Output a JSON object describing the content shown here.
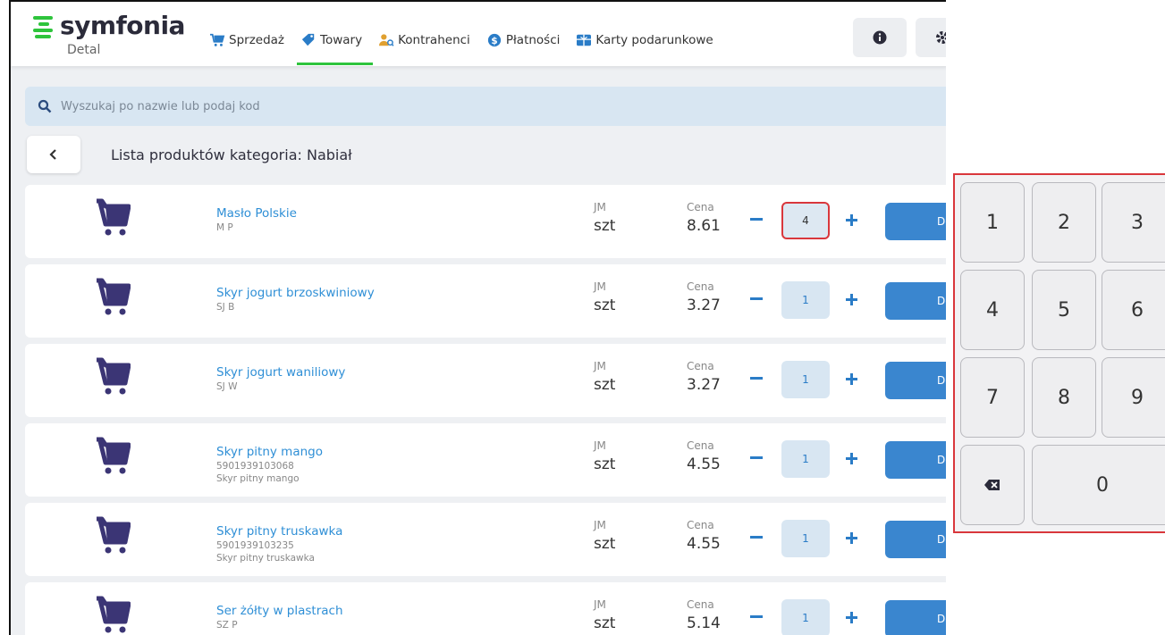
{
  "app": {
    "logo_name": "symfonia",
    "logo_sub": "Detal",
    "brand_color": "#2ec43c"
  },
  "nav": {
    "items": [
      {
        "label": "Sprzedaż",
        "icon": "cart-icon"
      },
      {
        "label": "Towary",
        "icon": "tag-icon"
      },
      {
        "label": "Kontrahenci",
        "icon": "users-icon"
      },
      {
        "label": "Płatności",
        "icon": "dollar-icon"
      },
      {
        "label": "Karty podarunkowe",
        "icon": "gift-icon"
      }
    ],
    "active_index": 1
  },
  "top_buttons": [
    {
      "icon": "info-icon"
    },
    {
      "icon": "settings-icon"
    }
  ],
  "search": {
    "placeholder": "Wyszukaj po nazwie lub podaj kod"
  },
  "list": {
    "back_label": "<",
    "title": "Lista produktów kategoria: Nabiał"
  },
  "columns": {
    "jm_label": "JM",
    "price_label": "Cena",
    "add_label": "Dc"
  },
  "products": [
    {
      "name": "Masło Polskie",
      "code": "M P",
      "desc": "",
      "jm": "szt",
      "price": "8.61",
      "qty": "4",
      "focused": true
    },
    {
      "name": "Skyr jogurt brzoskwiniowy",
      "code": "SJ B",
      "desc": "",
      "jm": "szt",
      "price": "3.27",
      "qty": "1",
      "focused": false
    },
    {
      "name": "Skyr jogurt waniliowy",
      "code": "SJ W",
      "desc": "",
      "jm": "szt",
      "price": "3.27",
      "qty": "1",
      "focused": false
    },
    {
      "name": "Skyr pitny mango",
      "code": "5901939103068",
      "desc": "Skyr pitny mango",
      "jm": "szt",
      "price": "4.55",
      "qty": "1",
      "focused": false
    },
    {
      "name": "Skyr pitny truskawka",
      "code": "5901939103235",
      "desc": "Skyr pitny truskawka",
      "jm": "szt",
      "price": "4.55",
      "qty": "1",
      "focused": false
    },
    {
      "name": "Ser żółty w plastrach",
      "code": "SZ P",
      "desc": "",
      "jm": "szt",
      "price": "5.14",
      "qty": "1",
      "focused": false
    }
  ],
  "keypad": {
    "keys": [
      "1",
      "2",
      "3",
      "4",
      "5",
      "6",
      "7",
      "8",
      "9",
      "0"
    ],
    "backspace_icon": "backspace-icon"
  },
  "colors": {
    "accent_blue": "#3a86cf",
    "link_blue": "#2f8fd6",
    "cart_purple": "#3b3575",
    "highlight_red": "#d9373c"
  }
}
